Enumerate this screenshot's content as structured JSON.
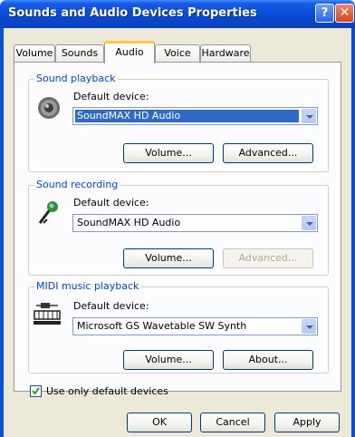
{
  "window": {
    "title": "Sounds and Audio Devices Properties",
    "help_label": "?",
    "close_label": "✕"
  },
  "tabs": [
    {
      "label": "Volume"
    },
    {
      "label": "Sounds"
    },
    {
      "label": "Audio",
      "active": true
    },
    {
      "label": "Voice"
    },
    {
      "label": "Hardware"
    }
  ],
  "playback": {
    "group_label": "Sound playback",
    "device_label": "Default device:",
    "device_value": "SoundMAX HD Audio",
    "volume_button": "Volume...",
    "advanced_button": "Advanced..."
  },
  "recording": {
    "group_label": "Sound recording",
    "device_label": "Default device:",
    "device_value": "SoundMAX HD Audio",
    "volume_button": "Volume...",
    "advanced_button": "Advanced..."
  },
  "midi": {
    "group_label": "MIDI music playback",
    "device_label": "Default device:",
    "device_value": "Microsoft GS Wavetable SW Synth",
    "volume_button": "Volume...",
    "about_button": "About..."
  },
  "options": {
    "default_only_label": "Use only default devices",
    "default_only_checked": true
  },
  "footer": {
    "ok": "OK",
    "cancel": "Cancel",
    "apply": "Apply"
  },
  "colors": {
    "title_bar": "#0a4fd8",
    "group_label": "#0046d5",
    "selection": "#316ac5",
    "active_tab_accent": "#ffc83c"
  },
  "icons": {
    "playback": "speaker-icon",
    "recording": "microphone-icon",
    "midi": "midi-keyboard-icon"
  }
}
